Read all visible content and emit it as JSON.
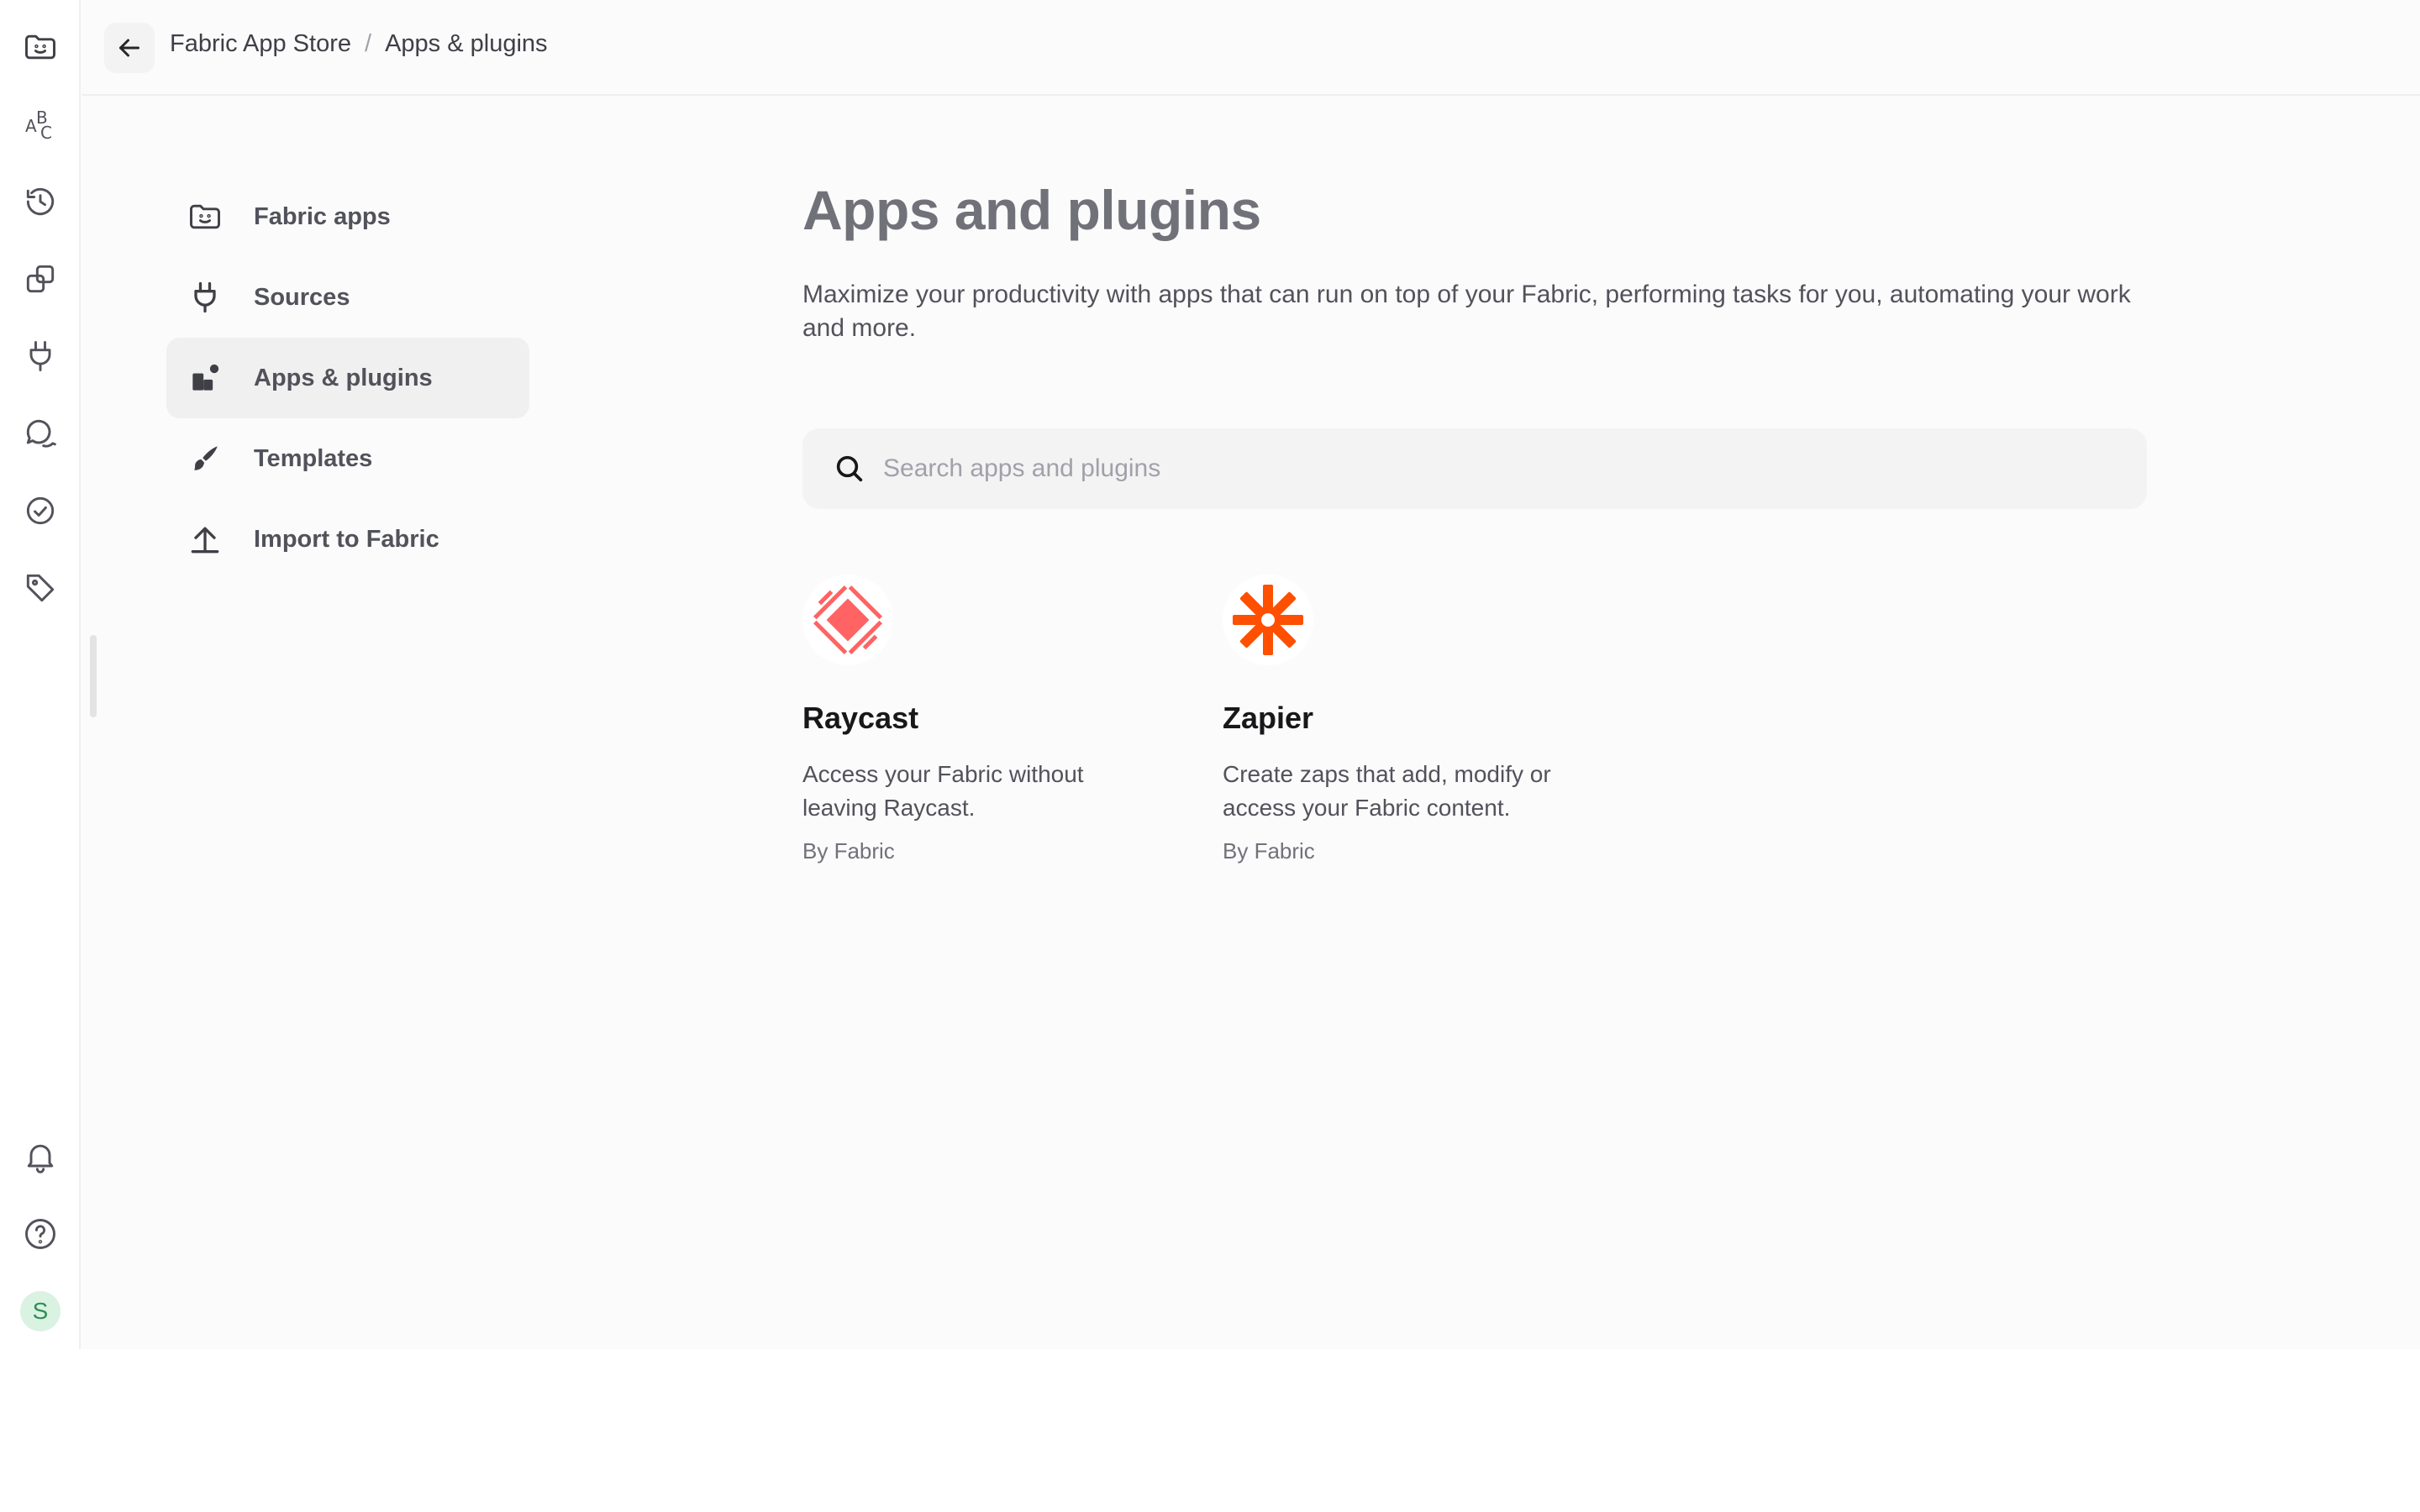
{
  "breadcrumb": {
    "root": "Fabric App Store",
    "separator": "/",
    "current": "Apps & plugins"
  },
  "rail": {
    "icons": [
      "fabric-home-icon",
      "abc-icon",
      "history-icon",
      "copy-icon",
      "plug-icon",
      "chat-icon",
      "check-circle-icon",
      "tag-icon",
      "bell-icon",
      "help-icon"
    ],
    "abc_letters": {
      "a": "A",
      "b": "B",
      "c": "C"
    },
    "avatar_initial": "S"
  },
  "nav": {
    "items": [
      {
        "label": "Fabric apps",
        "icon": "fabric-face-icon"
      },
      {
        "label": "Sources",
        "icon": "plug-icon"
      },
      {
        "label": "Apps & plugins",
        "icon": "apps-icon",
        "active": true
      },
      {
        "label": "Templates",
        "icon": "brush-icon"
      },
      {
        "label": "Import to Fabric",
        "icon": "upload-icon"
      }
    ]
  },
  "main": {
    "title": "Apps and plugins",
    "description": "Maximize your productivity with apps that can run on top of your Fabric, performing tasks for you, automating your work and more.",
    "search_placeholder": "Search apps and plugins",
    "search_value": ""
  },
  "cards": [
    {
      "name": "Raycast",
      "description": "Access your Fabric without leaving Raycast.",
      "author": "By Fabric",
      "icon": "raycast-logo-icon",
      "color": "#ff6363"
    },
    {
      "name": "Zapier",
      "description": "Create zaps that add, modify or access your Fabric content.",
      "author": "By Fabric",
      "icon": "zapier-logo-icon",
      "color": "#ff4f00"
    }
  ],
  "colors": {
    "accent_avatar": "#d9f2e2",
    "active_nav": "#f0f0f0"
  }
}
